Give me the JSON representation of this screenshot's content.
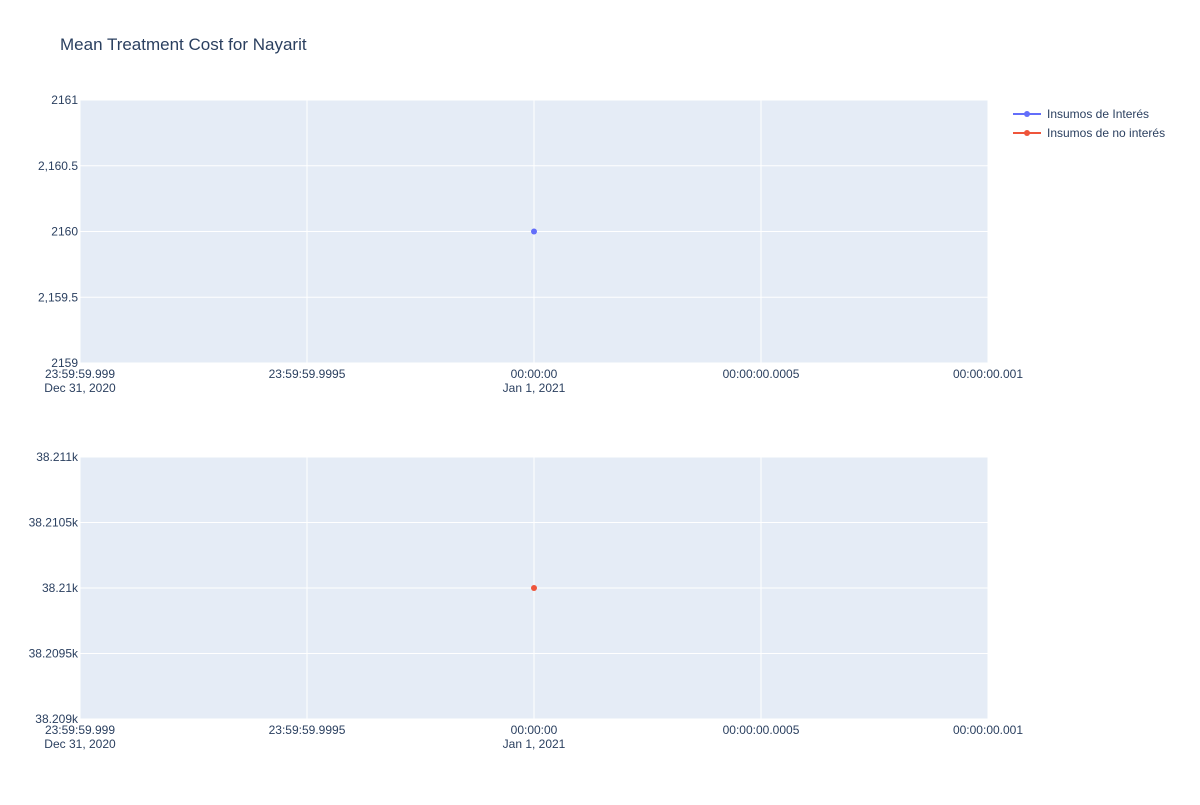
{
  "chart_data": {
    "type": "scatter",
    "title": "Mean Treatment Cost for Nayarit",
    "legend": {
      "position": "top-right",
      "entries": [
        {
          "name": "Insumos de Interés",
          "color": "#636efa"
        },
        {
          "name": "Insumos de no interés",
          "color": "#ef553b"
        }
      ]
    },
    "colors": {
      "plot_background": "#e5ecf6",
      "grid": "#ffffff",
      "text": "#2a3f5f"
    },
    "x_ticks": [
      {
        "line1": "23:59:59.999",
        "line2": "Dec 31, 2020"
      },
      {
        "line1": "23:59:59.9995",
        "line2": ""
      },
      {
        "line1": "00:00:00",
        "line2": "Jan 1, 2021"
      },
      {
        "line1": "00:00:00.0005",
        "line2": ""
      },
      {
        "line1": "00:00:00.001",
        "line2": ""
      }
    ],
    "subplots": [
      {
        "series_name": "Insumos de Interés",
        "color": "#636efa",
        "xlim": [
          "2020-12-31 23:59:59.999",
          "2021-01-01 00:00:00.001"
        ],
        "ylim": [
          2159,
          2161
        ],
        "y_ticks": [
          {
            "value": 2159,
            "label": "2159"
          },
          {
            "value": 2159.5,
            "label": "2,159.5"
          },
          {
            "value": 2160,
            "label": "2160"
          },
          {
            "value": 2160.5,
            "label": "2,160.5"
          },
          {
            "value": 2161,
            "label": "2161"
          }
        ],
        "points": [
          {
            "x": "2021-01-01 00:00:00",
            "y": 2160
          }
        ]
      },
      {
        "series_name": "Insumos de no interés",
        "color": "#ef553b",
        "xlim": [
          "2020-12-31 23:59:59.999",
          "2021-01-01 00:00:00.001"
        ],
        "ylim": [
          38209,
          38211
        ],
        "y_ticks": [
          {
            "value": 38209,
            "label": "38.209k"
          },
          {
            "value": 38209.5,
            "label": "38.2095k"
          },
          {
            "value": 38210,
            "label": "38.21k"
          },
          {
            "value": 38210.5,
            "label": "38.2105k"
          },
          {
            "value": 38211,
            "label": "38.211k"
          }
        ],
        "points": [
          {
            "x": "2021-01-01 00:00:00",
            "y": 38210
          }
        ]
      }
    ]
  }
}
